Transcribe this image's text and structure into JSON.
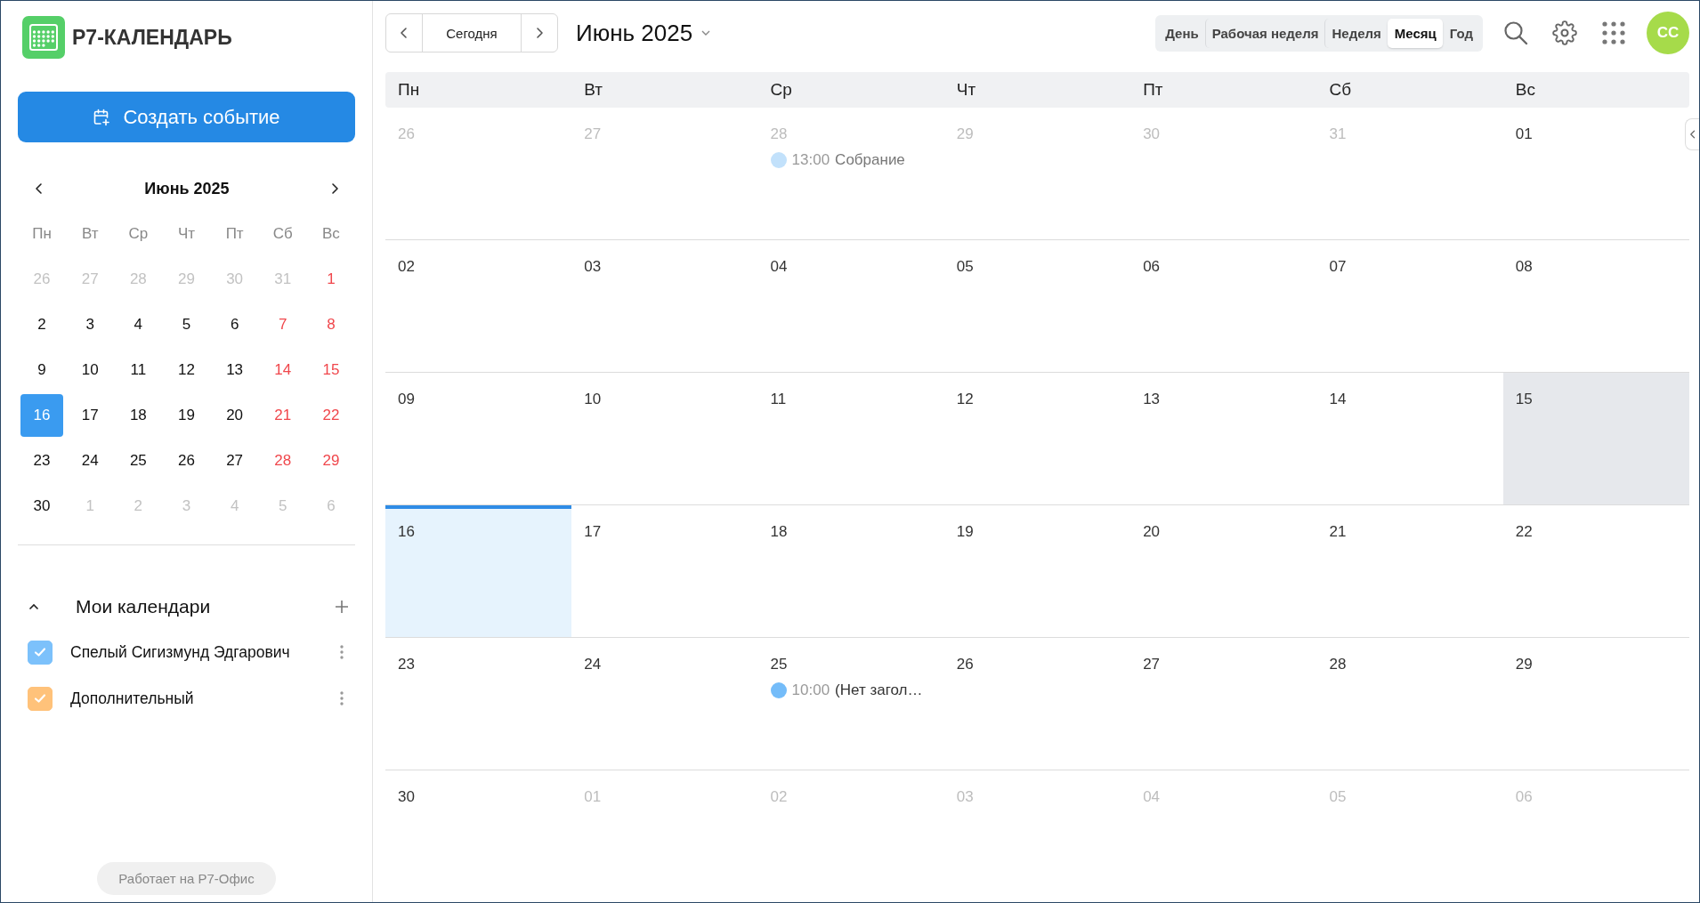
{
  "app": {
    "logo_text": "Р7-КАЛЕНДАРЬ"
  },
  "create_button": {
    "label": "Создать событие"
  },
  "mini_calendar": {
    "title": "Июнь 2025",
    "weekdays": [
      "Пн",
      "Вт",
      "Ср",
      "Чт",
      "Пт",
      "Сб",
      "Вс"
    ],
    "days": [
      {
        "day": "26",
        "outside": true,
        "weekend": false,
        "selected": false
      },
      {
        "day": "27",
        "outside": true,
        "weekend": false,
        "selected": false
      },
      {
        "day": "28",
        "outside": true,
        "weekend": false,
        "selected": false
      },
      {
        "day": "29",
        "outside": true,
        "weekend": false,
        "selected": false
      },
      {
        "day": "30",
        "outside": true,
        "weekend": false,
        "selected": false
      },
      {
        "day": "31",
        "outside": true,
        "weekend": false,
        "selected": false
      },
      {
        "day": "1",
        "outside": false,
        "weekend": true,
        "selected": false
      },
      {
        "day": "2",
        "outside": false,
        "weekend": false,
        "selected": false
      },
      {
        "day": "3",
        "outside": false,
        "weekend": false,
        "selected": false
      },
      {
        "day": "4",
        "outside": false,
        "weekend": false,
        "selected": false
      },
      {
        "day": "5",
        "outside": false,
        "weekend": false,
        "selected": false
      },
      {
        "day": "6",
        "outside": false,
        "weekend": false,
        "selected": false
      },
      {
        "day": "7",
        "outside": false,
        "weekend": true,
        "selected": false
      },
      {
        "day": "8",
        "outside": false,
        "weekend": true,
        "selected": false
      },
      {
        "day": "9",
        "outside": false,
        "weekend": false,
        "selected": false
      },
      {
        "day": "10",
        "outside": false,
        "weekend": false,
        "selected": false
      },
      {
        "day": "11",
        "outside": false,
        "weekend": false,
        "selected": false
      },
      {
        "day": "12",
        "outside": false,
        "weekend": false,
        "selected": false
      },
      {
        "day": "13",
        "outside": false,
        "weekend": false,
        "selected": false
      },
      {
        "day": "14",
        "outside": false,
        "weekend": true,
        "selected": false
      },
      {
        "day": "15",
        "outside": false,
        "weekend": true,
        "selected": false
      },
      {
        "day": "16",
        "outside": false,
        "weekend": false,
        "selected": true
      },
      {
        "day": "17",
        "outside": false,
        "weekend": false,
        "selected": false
      },
      {
        "day": "18",
        "outside": false,
        "weekend": false,
        "selected": false
      },
      {
        "day": "19",
        "outside": false,
        "weekend": false,
        "selected": false
      },
      {
        "day": "20",
        "outside": false,
        "weekend": false,
        "selected": false
      },
      {
        "day": "21",
        "outside": false,
        "weekend": true,
        "selected": false
      },
      {
        "day": "22",
        "outside": false,
        "weekend": true,
        "selected": false
      },
      {
        "day": "23",
        "outside": false,
        "weekend": false,
        "selected": false
      },
      {
        "day": "24",
        "outside": false,
        "weekend": false,
        "selected": false
      },
      {
        "day": "25",
        "outside": false,
        "weekend": false,
        "selected": false
      },
      {
        "day": "26",
        "outside": false,
        "weekend": false,
        "selected": false
      },
      {
        "day": "27",
        "outside": false,
        "weekend": false,
        "selected": false
      },
      {
        "day": "28",
        "outside": false,
        "weekend": true,
        "selected": false
      },
      {
        "day": "29",
        "outside": false,
        "weekend": true,
        "selected": false
      },
      {
        "day": "30",
        "outside": false,
        "weekend": false,
        "selected": false
      },
      {
        "day": "1",
        "outside": true,
        "weekend": false,
        "selected": false
      },
      {
        "day": "2",
        "outside": true,
        "weekend": false,
        "selected": false
      },
      {
        "day": "3",
        "outside": true,
        "weekend": false,
        "selected": false
      },
      {
        "day": "4",
        "outside": true,
        "weekend": false,
        "selected": false
      },
      {
        "day": "5",
        "outside": true,
        "weekend": false,
        "selected": false
      },
      {
        "day": "6",
        "outside": true,
        "weekend": false,
        "selected": false
      }
    ]
  },
  "my_calendars": {
    "title": "Мои календари",
    "expanded": true,
    "items": [
      {
        "name": "Спелый Сигизмунд Эдгарович",
        "checked": true,
        "color": "#7cc1fb"
      },
      {
        "name": "Дополнительный",
        "checked": true,
        "color": "#ffc27a"
      }
    ]
  },
  "footer": {
    "label": "Работает на Р7-Офис"
  },
  "toolbar": {
    "today_button": "Сегодня",
    "period_title": "Июнь 2025",
    "views": [
      {
        "label": "День",
        "selected": false
      },
      {
        "label": "Рабочая неделя",
        "selected": false
      },
      {
        "label": "Неделя",
        "selected": false
      },
      {
        "label": "Месяц",
        "selected": true
      },
      {
        "label": "Год",
        "selected": false
      }
    ],
    "avatar": "СС"
  },
  "month": {
    "weekdays": [
      "Пн",
      "Вт",
      "Ср",
      "Чт",
      "Пт",
      "Сб",
      "Вс"
    ],
    "days": [
      {
        "label": "26",
        "outside": true,
        "today": false,
        "selected": false
      },
      {
        "label": "27",
        "outside": true,
        "today": false,
        "selected": false
      },
      {
        "label": "28",
        "outside": true,
        "today": false,
        "selected": false,
        "events": [
          {
            "time": "13:00",
            "title": "Собрание",
            "color": "#c2e1fb",
            "past": true
          }
        ]
      },
      {
        "label": "29",
        "outside": true,
        "today": false,
        "selected": false
      },
      {
        "label": "30",
        "outside": true,
        "today": false,
        "selected": false
      },
      {
        "label": "31",
        "outside": true,
        "today": false,
        "selected": false
      },
      {
        "label": "01",
        "outside": false,
        "today": false,
        "selected": false
      },
      {
        "label": "02",
        "outside": false,
        "today": false,
        "selected": false
      },
      {
        "label": "03",
        "outside": false,
        "today": false,
        "selected": false
      },
      {
        "label": "04",
        "outside": false,
        "today": false,
        "selected": false
      },
      {
        "label": "05",
        "outside": false,
        "today": false,
        "selected": false
      },
      {
        "label": "06",
        "outside": false,
        "today": false,
        "selected": false
      },
      {
        "label": "07",
        "outside": false,
        "today": false,
        "selected": false
      },
      {
        "label": "08",
        "outside": false,
        "today": false,
        "selected": false
      },
      {
        "label": "09",
        "outside": false,
        "today": false,
        "selected": false
      },
      {
        "label": "10",
        "outside": false,
        "today": false,
        "selected": false
      },
      {
        "label": "11",
        "outside": false,
        "today": false,
        "selected": false
      },
      {
        "label": "12",
        "outside": false,
        "today": false,
        "selected": false
      },
      {
        "label": "13",
        "outside": false,
        "today": false,
        "selected": false
      },
      {
        "label": "14",
        "outside": false,
        "today": false,
        "selected": false
      },
      {
        "label": "15",
        "outside": false,
        "today": false,
        "selected": true
      },
      {
        "label": "16",
        "outside": false,
        "today": true,
        "selected": false
      },
      {
        "label": "17",
        "outside": false,
        "today": false,
        "selected": false
      },
      {
        "label": "18",
        "outside": false,
        "today": false,
        "selected": false
      },
      {
        "label": "19",
        "outside": false,
        "today": false,
        "selected": false
      },
      {
        "label": "20",
        "outside": false,
        "today": false,
        "selected": false
      },
      {
        "label": "21",
        "outside": false,
        "today": false,
        "selected": false
      },
      {
        "label": "22",
        "outside": false,
        "today": false,
        "selected": false
      },
      {
        "label": "23",
        "outside": false,
        "today": false,
        "selected": false
      },
      {
        "label": "24",
        "outside": false,
        "today": false,
        "selected": false
      },
      {
        "label": "25",
        "outside": false,
        "today": false,
        "selected": false,
        "events": [
          {
            "time": "10:00",
            "title": "(Нет загол…",
            "color": "#74bcf9",
            "past": false
          }
        ]
      },
      {
        "label": "26",
        "outside": false,
        "today": false,
        "selected": false
      },
      {
        "label": "27",
        "outside": false,
        "today": false,
        "selected": false
      },
      {
        "label": "28",
        "outside": false,
        "today": false,
        "selected": false
      },
      {
        "label": "29",
        "outside": false,
        "today": false,
        "selected": false
      },
      {
        "label": "30",
        "outside": false,
        "today": false,
        "selected": false
      },
      {
        "label": "01",
        "outside": true,
        "today": false,
        "selected": false
      },
      {
        "label": "02",
        "outside": true,
        "today": false,
        "selected": false
      },
      {
        "label": "03",
        "outside": true,
        "today": false,
        "selected": false
      },
      {
        "label": "04",
        "outside": true,
        "today": false,
        "selected": false
      },
      {
        "label": "05",
        "outside": true,
        "today": false,
        "selected": false
      },
      {
        "label": "06",
        "outside": true,
        "today": false,
        "selected": false
      }
    ]
  }
}
